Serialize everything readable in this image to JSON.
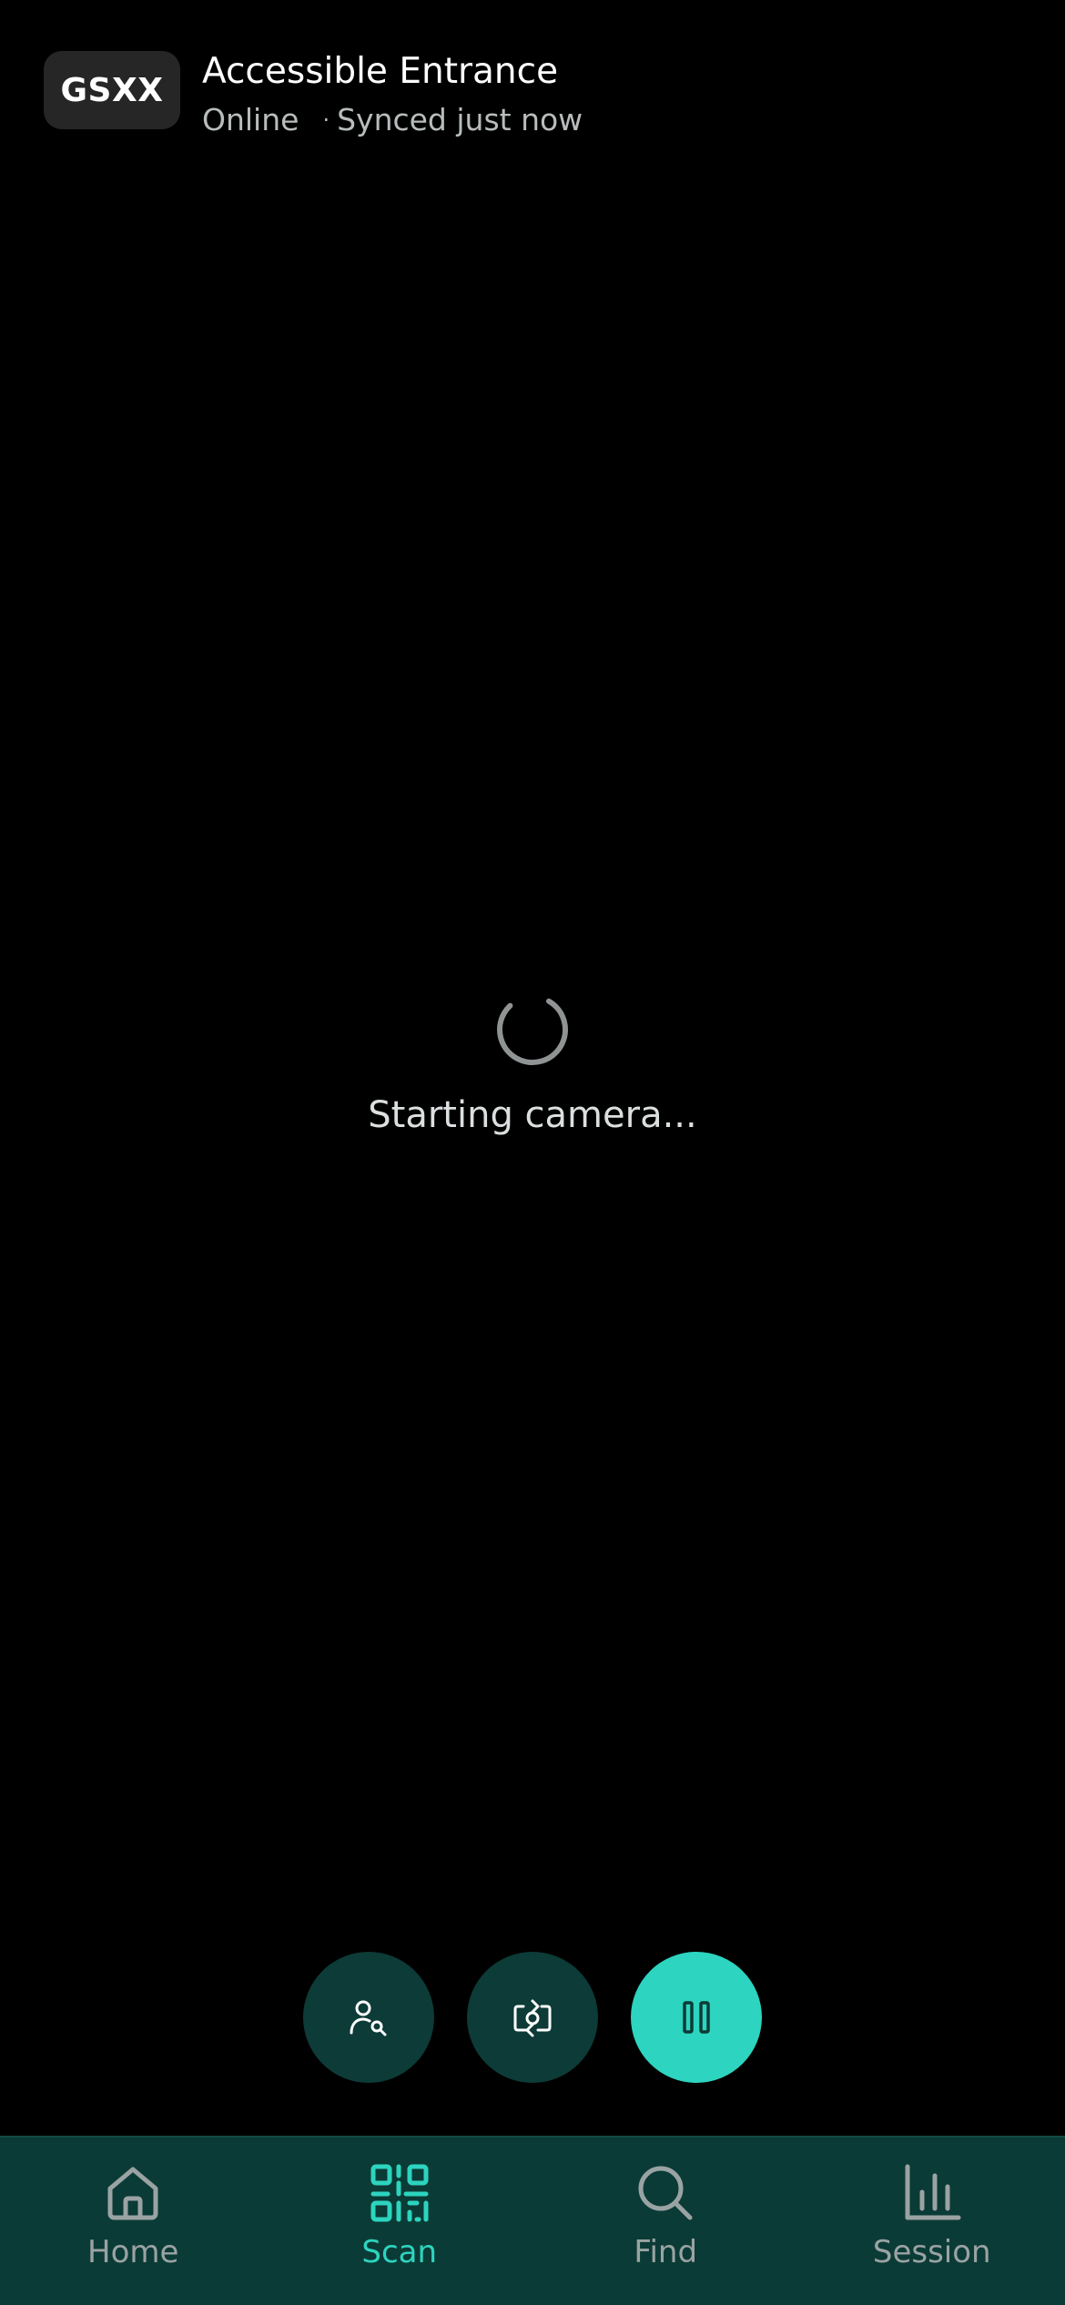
{
  "header": {
    "event_code": "GSXX",
    "title": "Accessible Entrance",
    "status": "Online",
    "separator": "·",
    "sync_status": "Synced just now"
  },
  "loading": {
    "message": "Starting camera..."
  },
  "actions": [
    {
      "icon": "user-search-icon",
      "label": "Search attendee"
    },
    {
      "icon": "switch-camera-icon",
      "label": "Switch camera"
    },
    {
      "icon": "pause-icon",
      "label": "Pause"
    }
  ],
  "nav": {
    "items": [
      {
        "label": "Home",
        "icon": "home-icon",
        "active": false
      },
      {
        "label": "Scan",
        "icon": "qr-code-icon",
        "active": true
      },
      {
        "label": "Find",
        "icon": "search-icon",
        "active": false
      },
      {
        "label": "Session",
        "icon": "bar-chart-icon",
        "active": false
      }
    ]
  },
  "colors": {
    "background": "#000000",
    "accent": "#2dd4bf",
    "nav_background": "#0b3b36",
    "fab_dark": "#0d3b37",
    "badge_background": "#262626",
    "muted_text": "#b8bcbd"
  }
}
